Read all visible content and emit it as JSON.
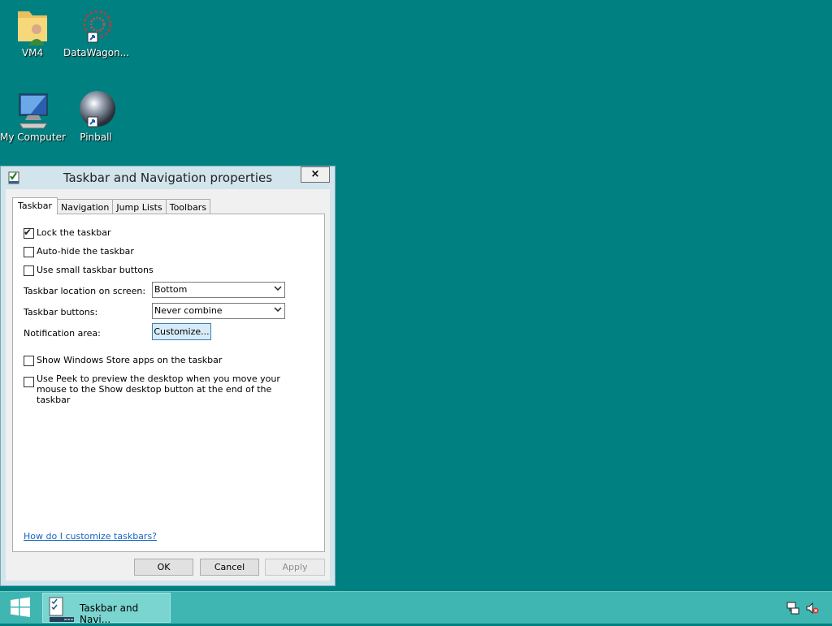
{
  "desktop": {
    "icons": [
      {
        "label": "VM4",
        "icon": "user-folder-icon"
      },
      {
        "label": "DataWagon...",
        "icon": "datawagon-shortcut-icon"
      },
      {
        "label": "My Computer",
        "icon": "computer-icon"
      },
      {
        "label": "Pinball",
        "icon": "pinball-shortcut-icon"
      }
    ]
  },
  "dialog": {
    "title": "Taskbar and Navigation properties",
    "close_label": "×",
    "tabs": [
      {
        "label": "Taskbar",
        "active": true
      },
      {
        "label": "Navigation",
        "active": false
      },
      {
        "label": "Jump Lists",
        "active": false
      },
      {
        "label": "Toolbars",
        "active": false
      }
    ],
    "options": {
      "lock": {
        "label": "Lock the taskbar",
        "checked": true
      },
      "autohide": {
        "label": "Auto-hide the taskbar",
        "checked": false
      },
      "small_buttons": {
        "label": "Use small taskbar buttons",
        "checked": false
      },
      "store_apps": {
        "label": "Show Windows Store apps on the taskbar",
        "checked": false
      },
      "peek": {
        "label": "Use Peek to preview the desktop when you move your mouse to the Show desktop button at the end of the taskbar",
        "checked": false
      }
    },
    "location": {
      "label": "Taskbar location on screen:",
      "value": "Bottom"
    },
    "buttons_setting": {
      "label": "Taskbar buttons:",
      "value": "Never combine"
    },
    "notification": {
      "label": "Notification area:",
      "button": "Customize..."
    },
    "help_link": "How do I customize taskbars?",
    "footer": {
      "ok": "OK",
      "cancel": "Cancel",
      "apply": "Apply"
    },
    "check_glyph": "✔"
  },
  "taskbar": {
    "item_label": "Taskbar and Navi...",
    "accent": "#3fb6b1"
  },
  "colors": {
    "desktop": "#008080",
    "link": "#1565c0"
  }
}
